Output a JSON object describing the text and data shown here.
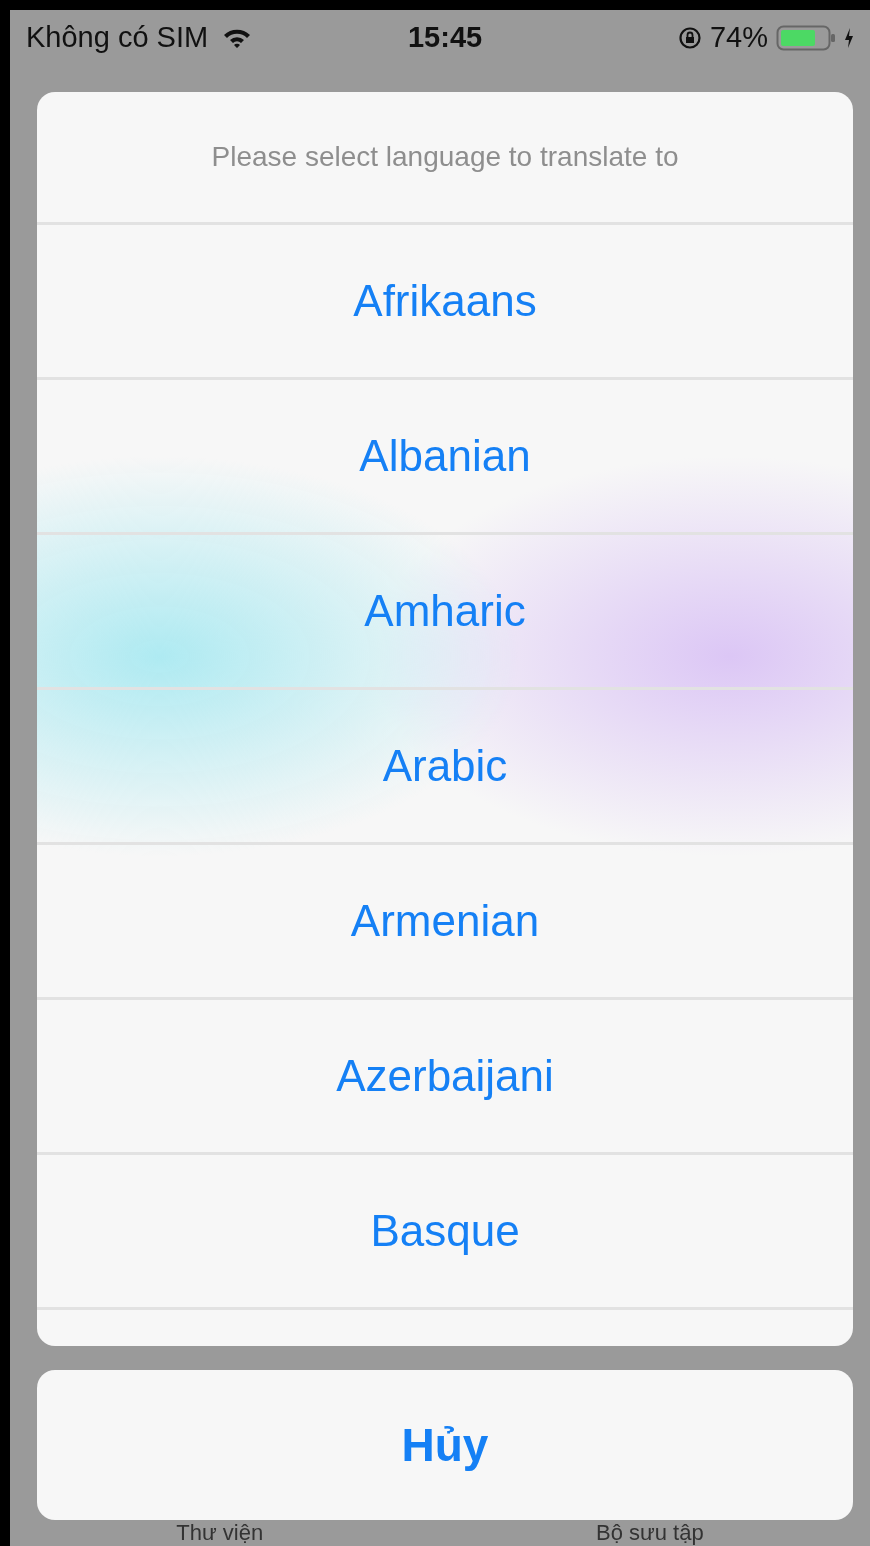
{
  "status_bar": {
    "carrier": "Không có SIM",
    "time": "15:45",
    "battery": "74%"
  },
  "action_sheet": {
    "title": "Please select language to translate to",
    "options": [
      {
        "label": "Afrikaans"
      },
      {
        "label": "Albanian"
      },
      {
        "label": "Amharic"
      },
      {
        "label": "Arabic"
      },
      {
        "label": "Armenian"
      },
      {
        "label": "Azerbaijani"
      },
      {
        "label": "Basque"
      }
    ],
    "cancel": "Hủy"
  },
  "tab_bar": {
    "items": [
      {
        "label": "Thư viện"
      },
      {
        "label": "Bộ sưu tập"
      }
    ]
  }
}
